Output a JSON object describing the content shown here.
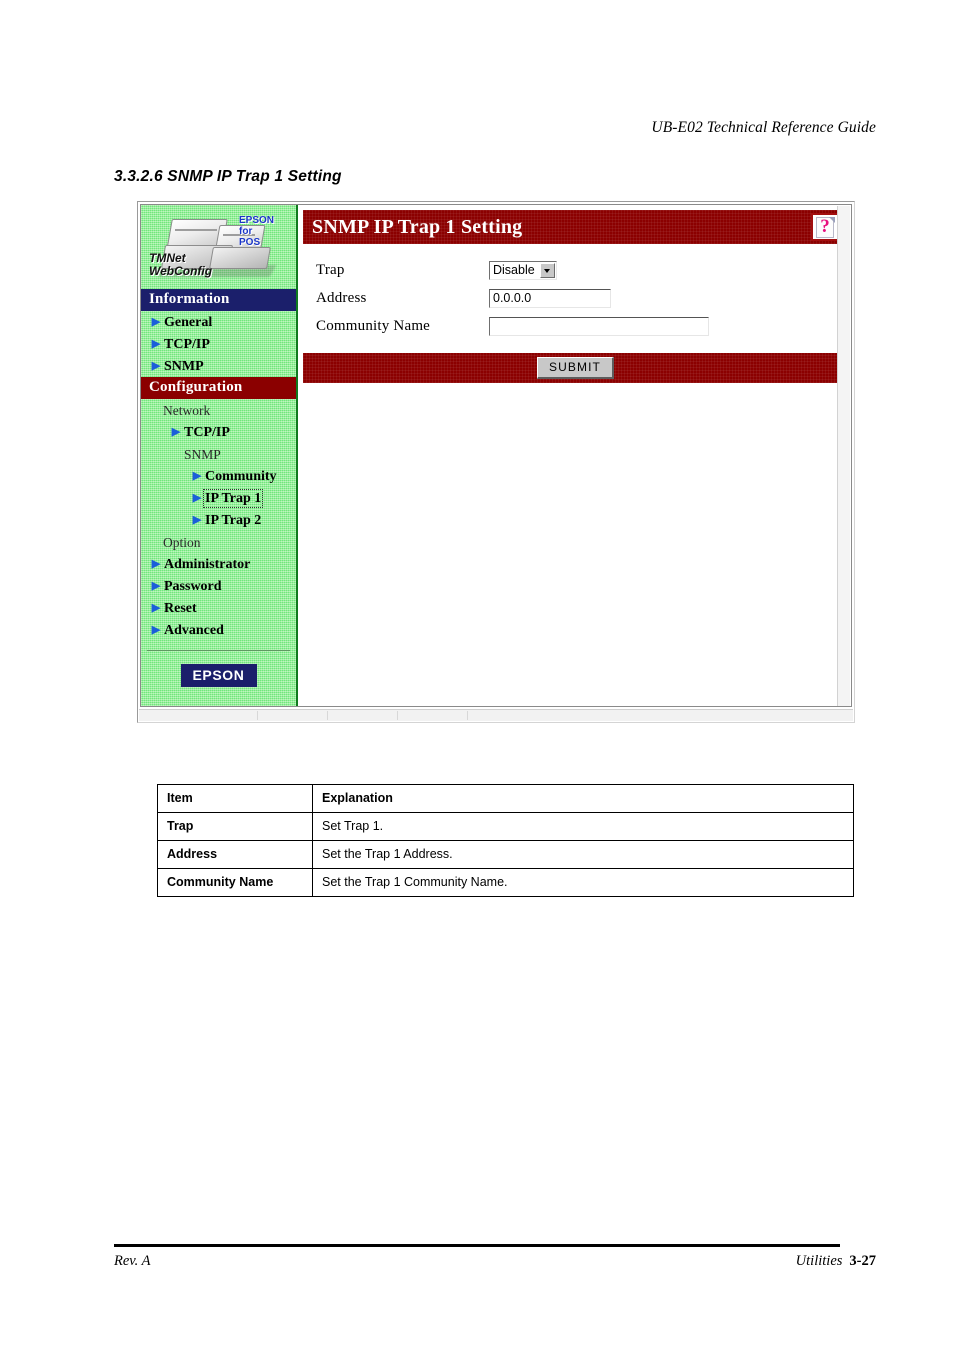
{
  "page": {
    "running_head": "UB-E02 Technical Reference Guide",
    "section_heading": "3.3.2.6 SNMP IP Trap 1 Setting",
    "footer_left": "Rev. A",
    "footer_right_label": "Utilities",
    "footer_page_number": "3-27"
  },
  "colors": {
    "information_header_bg": "#1b1f6b",
    "configuration_header_bg": "#8b0000",
    "title_bar_bg": "#8b0000",
    "sidebar_bg": "#8cf08c",
    "bullet_blue": "#1b5fd9",
    "help_qmark": "#e8117f",
    "epson_badge_bg": "#1b1f6b",
    "epson_for_pos_text": "#1b36c8"
  },
  "browser": {
    "sidebar": {
      "logo": {
        "brand_line1": "EPSON",
        "brand_line2": "for",
        "brand_line3": "POS",
        "product_line1": "TMNet",
        "product_line2": "WebConfig"
      },
      "sections": [
        {
          "header": "Information",
          "items": [
            {
              "label": "General",
              "type": "link",
              "level": 0,
              "bullet": true,
              "focused": false
            },
            {
              "label": "TCP/IP",
              "type": "link",
              "level": 0,
              "bullet": true,
              "focused": false
            },
            {
              "label": "SNMP",
              "type": "link",
              "level": 0,
              "bullet": true,
              "focused": false
            }
          ]
        },
        {
          "header": "Configuration",
          "items": [
            {
              "label": "Network",
              "type": "group",
              "level": 1,
              "bullet": false,
              "focused": false
            },
            {
              "label": "TCP/IP",
              "type": "link",
              "level": 1,
              "bullet": true,
              "focused": false
            },
            {
              "label": "SNMP",
              "type": "group",
              "level": 2,
              "bullet": false,
              "focused": false
            },
            {
              "label": "Community",
              "type": "link",
              "level": 2,
              "bullet": true,
              "focused": false
            },
            {
              "label": "IP Trap 1",
              "type": "link",
              "level": 2,
              "bullet": true,
              "focused": true
            },
            {
              "label": "IP Trap 2",
              "type": "link",
              "level": 2,
              "bullet": true,
              "focused": false
            },
            {
              "label": "Option",
              "type": "group",
              "level": 1,
              "bullet": false,
              "focused": false
            },
            {
              "label": "Administrator",
              "type": "link",
              "level": 0,
              "bullet": true,
              "focused": false
            },
            {
              "label": "Password",
              "type": "link",
              "level": 0,
              "bullet": true,
              "focused": false
            },
            {
              "label": "Reset",
              "type": "link",
              "level": 0,
              "bullet": true,
              "focused": false
            },
            {
              "label": "Advanced",
              "type": "link",
              "level": 0,
              "bullet": true,
              "focused": false
            }
          ]
        }
      ],
      "badge": "EPSON"
    },
    "content": {
      "title": "SNMP IP Trap 1 Setting",
      "help_icon_glyph": "?",
      "fields": {
        "trap": {
          "label": "Trap",
          "type": "select",
          "value": "Disable"
        },
        "address": {
          "label": "Address",
          "type": "text",
          "value": "0.0.0.0",
          "placeholder": ""
        },
        "community_name": {
          "label": "Community Name",
          "type": "text",
          "value": "",
          "placeholder": ""
        }
      },
      "submit_label": "SUBMIT"
    }
  },
  "explanation_table": {
    "headers": {
      "item": "Item",
      "explanation": "Explanation"
    },
    "rows": [
      {
        "item": "Trap",
        "explanation": "Set Trap 1."
      },
      {
        "item": "Address",
        "explanation": "Set the Trap 1 Address."
      },
      {
        "item": "Community Name",
        "explanation": "Set the Trap 1 Community Name."
      }
    ]
  }
}
